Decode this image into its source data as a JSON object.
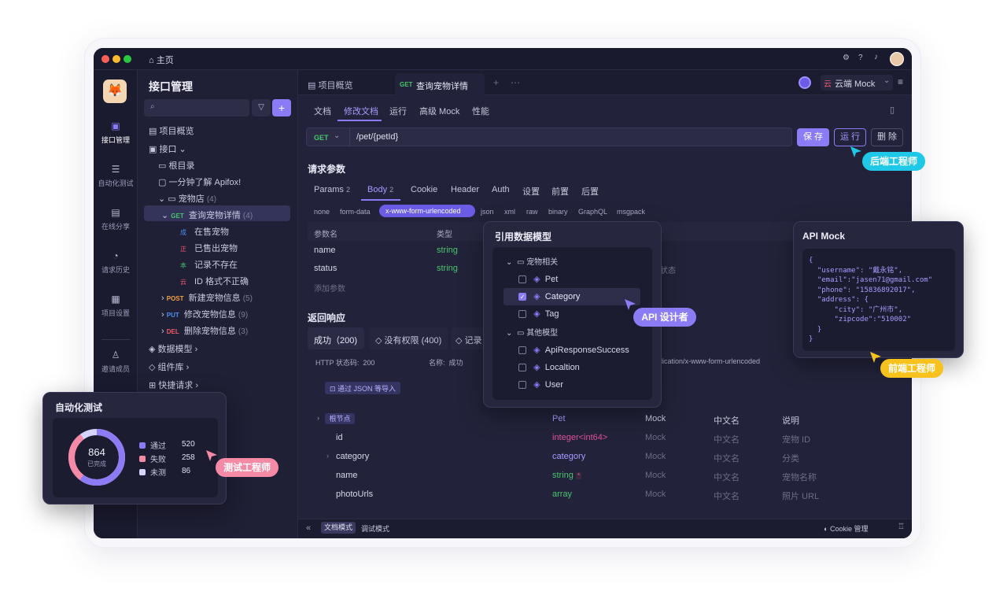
{
  "titlebar": {
    "home_label": "主页"
  },
  "rail": [
    {
      "label": "接口管理"
    },
    {
      "label": "自动化测试"
    },
    {
      "label": "在线分享"
    },
    {
      "label": "请求历史"
    },
    {
      "label": "项目设置"
    },
    {
      "label": "邀请成员"
    }
  ],
  "sidebar": {
    "title": "接口管理",
    "overview": "项目概览",
    "api": "接口",
    "root": "根目录",
    "intro": "一分钟了解 Apifox!",
    "petstore": "宠物店",
    "petstore_count": "(4)",
    "get_method": "GET",
    "get_detail": "查询宠物详情",
    "get_count": "(4)",
    "cases": [
      {
        "badge": "成",
        "label": "在售宠物",
        "color": "#4c8ff0"
      },
      {
        "badge": "正",
        "label": "已售出宠物",
        "color": "#f05b6a"
      },
      {
        "badge": "本",
        "label": "记录不存在",
        "color": "#49c46c"
      },
      {
        "badge": "云",
        "label": "ID 格式不正确",
        "color": "#f05b6a"
      }
    ],
    "post_method": "POST",
    "post_label": "新建宠物信息",
    "post_count": "(5)",
    "put_method": "PUT",
    "put_label": "修改宠物信息",
    "put_count": "(9)",
    "del_method": "DEL",
    "del_label": "删除宠物信息",
    "del_count": "(3)",
    "data_model": "数据模型",
    "components": "组件库",
    "quick_request": "快捷请求"
  },
  "tabs": {
    "overview": "项目概览",
    "active_method": "GET",
    "active_label": "查询宠物详情"
  },
  "env": {
    "badge": "云",
    "label": "云端 Mock"
  },
  "subtabs": [
    "文档",
    "修改文档",
    "运行",
    "高级 Mock",
    "性能"
  ],
  "request": {
    "method": "GET",
    "path": "/pet/{petId}",
    "save": "保 存",
    "run": "运 行",
    "delete": "删 除"
  },
  "params": {
    "title": "请求参数",
    "tabs": [
      {
        "label": "Params",
        "count": "2"
      },
      {
        "label": "Body",
        "count": "2"
      },
      {
        "label": "Cookie",
        "count": ""
      },
      {
        "label": "Header",
        "count": ""
      },
      {
        "label": "Auth",
        "count": ""
      },
      {
        "label": "设置",
        "count": ""
      },
      {
        "label": "前置",
        "count": ""
      },
      {
        "label": "后置",
        "count": ""
      }
    ],
    "body_types": [
      "none",
      "form-data",
      "x-www-form-urlencoded",
      "json",
      "xml",
      "raw",
      "binary",
      "GraphQL",
      "msgpack"
    ],
    "col_name": "参数名",
    "col_type": "类型",
    "rows": [
      {
        "name": "name",
        "type": "string"
      },
      {
        "name": "status",
        "type": "string",
        "desc": "状态"
      }
    ],
    "add": "添加参数"
  },
  "response": {
    "title": "返回响应",
    "tabs": [
      "成功（200)",
      "没有权限 (400)",
      "记录"
    ],
    "status_label": "HTTP 状态码:",
    "status_value": "200",
    "name_label": "名称:",
    "name_value": "成功",
    "content_type": "plication/x-www-form-urlencoded",
    "import_json": "通过 JSON 等导入",
    "root_tag": "根节点",
    "header": {
      "type": "Pet",
      "mock": "Mock",
      "cn": "中文名",
      "desc": "说明"
    },
    "rows": [
      {
        "name": "id",
        "type": "integer<int64>",
        "mock": "Mock",
        "cn": "中文名",
        "desc": "宠物 ID"
      },
      {
        "name": "category",
        "type": "category",
        "mock": "Mock",
        "cn": "中文名",
        "desc": "分类"
      },
      {
        "name": "name",
        "type": "string",
        "mock": "Mock",
        "cn": "中文名",
        "desc": "宠物名称"
      },
      {
        "name": "photoUrls",
        "type": "array",
        "mock": "Mock",
        "cn": "中文名",
        "desc": "照片 URL"
      }
    ]
  },
  "footer": {
    "doc_mode": "文档模式",
    "debug_mode": "调试模式",
    "cookie": "Cookie 管理"
  },
  "model_popup": {
    "title": "引用数据模型",
    "group1": "宠物相关",
    "group1_items": [
      {
        "label": "Pet",
        "checked": false
      },
      {
        "label": "Category",
        "checked": true
      },
      {
        "label": "Tag",
        "checked": false
      }
    ],
    "group2": "其他模型",
    "group2_items": [
      {
        "label": "ApiResponseSuccess",
        "checked": false
      },
      {
        "label": "Localtion",
        "checked": false
      },
      {
        "label": "User",
        "checked": false
      }
    ]
  },
  "mock_card": {
    "title": "API Mock",
    "lines": [
      "{",
      "  \"username\": \"戴永铭\",",
      "  \"email\":\"jasen71@gmail.com\"",
      "  \"phone\": \"15836892017\",",
      "  \"address\": {",
      "      \"city\": \"广州市\",",
      "      \"zipcode\":\"510002\"",
      "  }",
      "}"
    ]
  },
  "auto_test": {
    "title": "自动化测试",
    "total": "864",
    "total_label": "已完成",
    "legend": [
      {
        "label": "通过",
        "value": "520",
        "color": "#8b7cf6"
      },
      {
        "label": "失败",
        "value": "258",
        "color": "#f58aa6"
      },
      {
        "label": "未测",
        "value": "86",
        "color": "#d6d3ff"
      }
    ]
  },
  "roles": {
    "backend": "后端工程师",
    "api_designer": "API 设计者",
    "frontend": "前端工程师",
    "tester": "测试工程师"
  },
  "colors": {
    "accent": "#8b7cf6",
    "backend": "#1ec8e6",
    "frontend": "#f7c21e",
    "tester": "#f58aa6",
    "api_designer": "#8b7cf6"
  }
}
